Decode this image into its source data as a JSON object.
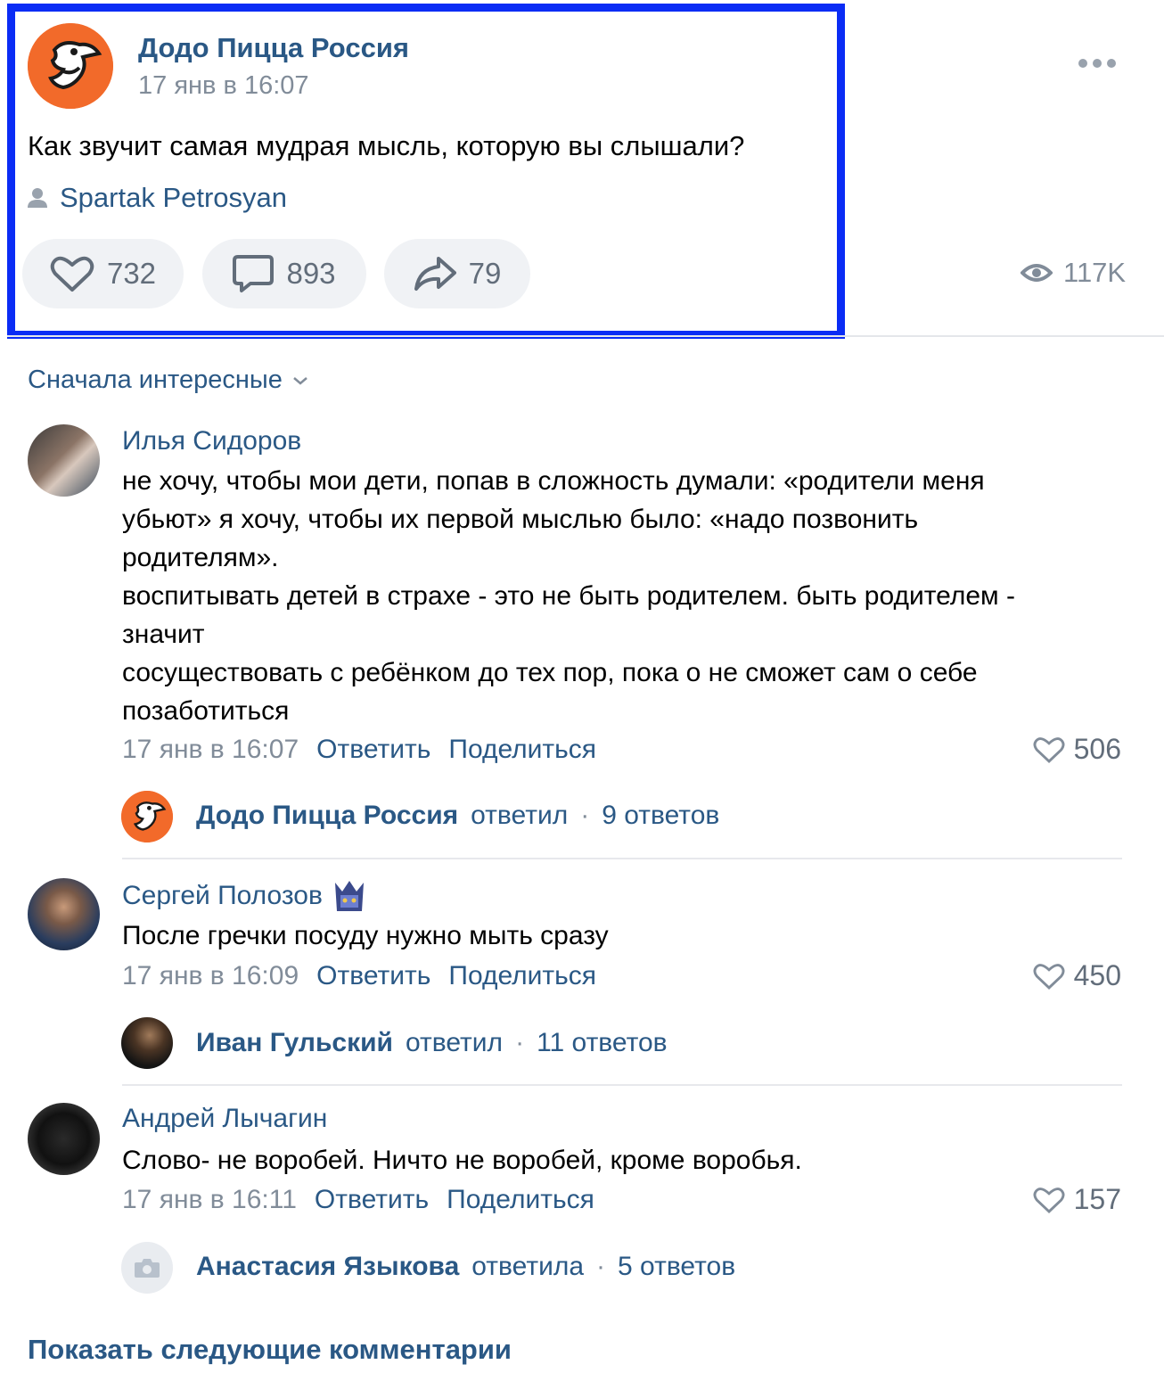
{
  "colors": {
    "highlight": "#0a2cf5",
    "link": "#2a5885",
    "muted": "#818c99",
    "dodo_orange": "#f26a2a"
  },
  "post": {
    "author": "Додо Пицца Россия",
    "date": "17 янв в 16:07",
    "text": "Как звучит самая мудрая мысль, которую вы слышали?",
    "signer": "Spartak Petrosyan",
    "likes": "732",
    "comments": "893",
    "shares": "79",
    "views": "117K"
  },
  "sort": {
    "label": "Сначала интересные"
  },
  "comments": [
    {
      "author": "Илья Сидоров",
      "text_lines": [
        "не хочу, чтобы мои дети, попав в сложность думали: «родители меня",
        "убьют» я хочу, чтобы их первой мыслью было: «надо позвонить",
        "родителям».",
        "воспитывать детей в страхе - это не быть родителем. быть родителем -",
        "значит",
        "сосуществовать с ребёнком до тех пор, пока о не сможет сам о себе",
        "позаботиться"
      ],
      "date": "17 янв в 16:07",
      "reply_label": "Ответить",
      "share_label": "Поделиться",
      "likes": "506",
      "thread": {
        "name": "Додо Пицца Россия",
        "verb": "ответил",
        "dot": "·",
        "count": "9 ответов"
      }
    },
    {
      "author": "Сергей Полозов",
      "text_lines": [
        "После гречки посуду нужно мыть сразу"
      ],
      "date": "17 янв в 16:09",
      "reply_label": "Ответить",
      "share_label": "Поделиться",
      "likes": "450",
      "thread": {
        "name": "Иван Гульский",
        "verb": "ответил",
        "dot": "·",
        "count": "11 ответов"
      }
    },
    {
      "author": "Андрей Лычагин",
      "text_lines": [
        "Слово- не воробей. Ничто не воробей, кроме воробья."
      ],
      "date": "17 янв в 16:11",
      "reply_label": "Ответить",
      "share_label": "Поделиться",
      "likes": "157",
      "thread": {
        "name": "Анастасия Языкова",
        "verb": "ответила",
        "dot": "·",
        "count": "5 ответов"
      }
    }
  ],
  "show_more": "Показать следующие комментарии"
}
